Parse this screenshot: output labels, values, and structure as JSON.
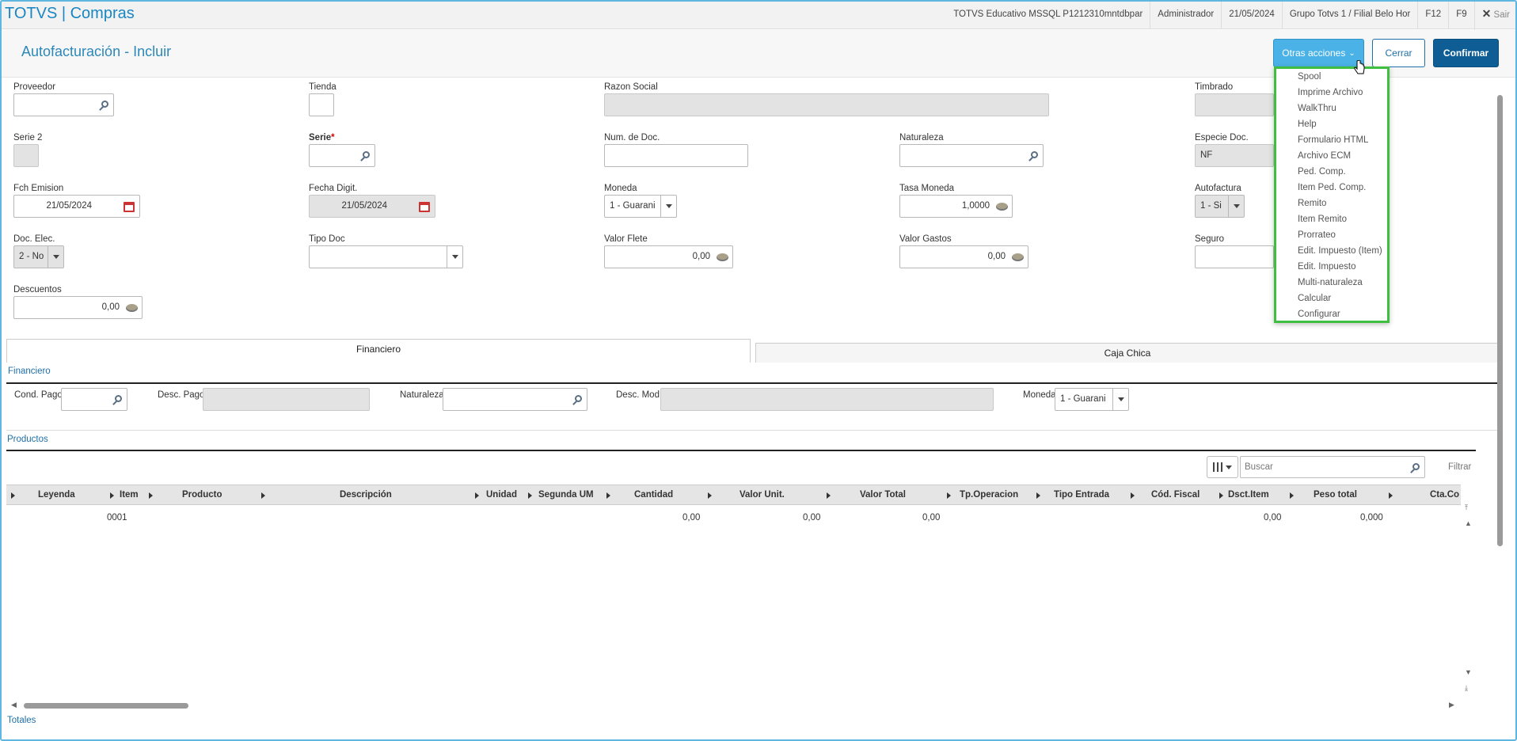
{
  "app": {
    "title": "TOTVS | Compras"
  },
  "topbar": {
    "env": "TOTVS Educativo MSSQL P1212310mntdbpar",
    "user": "Administrador",
    "date": "21/05/2024",
    "branch": "Grupo Totvs 1 / Filial Belo Hor",
    "f12": "F12",
    "f9": "F9",
    "exit": "Sair",
    "exit_icon": "close-icon"
  },
  "page": {
    "title": "Autofacturación - Incluir"
  },
  "actions": {
    "otras": "Otras acciones",
    "cerrar": "Cerrar",
    "confirmar": "Confirmar"
  },
  "menu": [
    "Spool",
    "Imprime Archivo",
    "WalkThru",
    "Help",
    "Formulario HTML",
    "Archivo ECM",
    "Ped. Comp.",
    "Item Ped. Comp.",
    "Remito",
    "Item Remito",
    "Prorrateo",
    "Edit. Impuesto (Item)",
    "Edit. Impuesto",
    "Multi-naturaleza",
    "Calcular",
    "Configurar"
  ],
  "form": {
    "proveedor": "Proveedor",
    "tienda": "Tienda",
    "razon": "Razon Social",
    "timbrado": "Timbrado",
    "serie2": "Serie 2",
    "serie": "Serie",
    "numdoc": "Num. de Doc.",
    "naturaleza": "Naturaleza",
    "especie": "Especie Doc.",
    "especie_val": "NF",
    "fch": "Fch Emision",
    "fch_val": "21/05/2024",
    "fechadig": "Fecha Digit.",
    "fechadig_val": "21/05/2024",
    "moneda": "Moneda",
    "moneda_val": "1 - Guarani",
    "tasa": "Tasa Moneda",
    "tasa_val": "1,0000",
    "autof": "Autofactura",
    "autof_val": "1 - Si",
    "docelec": "Doc. Elec.",
    "docelec_val": "2 - No",
    "tipodoc": "Tipo Doc",
    "flete": "Valor Flete",
    "flete_val": "0,00",
    "gastos": "Valor Gastos",
    "gastos_val": "0,00",
    "seguro": "Seguro",
    "desc": "Descuentos",
    "desc_val": "0,00"
  },
  "tabs": {
    "fin": "Financiero",
    "caja": "Caja Chica"
  },
  "fin": {
    "section": "Financiero",
    "cond": "Cond. Pago",
    "descpago": "Desc. Pago",
    "nat": "Naturaleza",
    "descmod": "Desc. Mod.",
    "moneda": "Moneda",
    "moneda_val": "1 - Guarani"
  },
  "products": {
    "section": "Productos",
    "search_placeholder": "Buscar",
    "filter": "Filtrar",
    "columns": [
      "Leyenda",
      "Item",
      "Producto",
      "Descripción",
      "Unidad",
      "Segunda UM",
      "Cantidad",
      "Valor Unit.",
      "Valor Total",
      "Tp.Operacion",
      "Tipo Entrada",
      "Cód. Fiscal",
      "Dsct.Item",
      "Peso total",
      "Cta.Co"
    ],
    "row": {
      "item": "0001",
      "cantidad": "0,00",
      "unit": "0,00",
      "total": "0,00",
      "dsct": "0,00",
      "peso": "0,000"
    }
  },
  "footer": {
    "totales": "Totales"
  }
}
